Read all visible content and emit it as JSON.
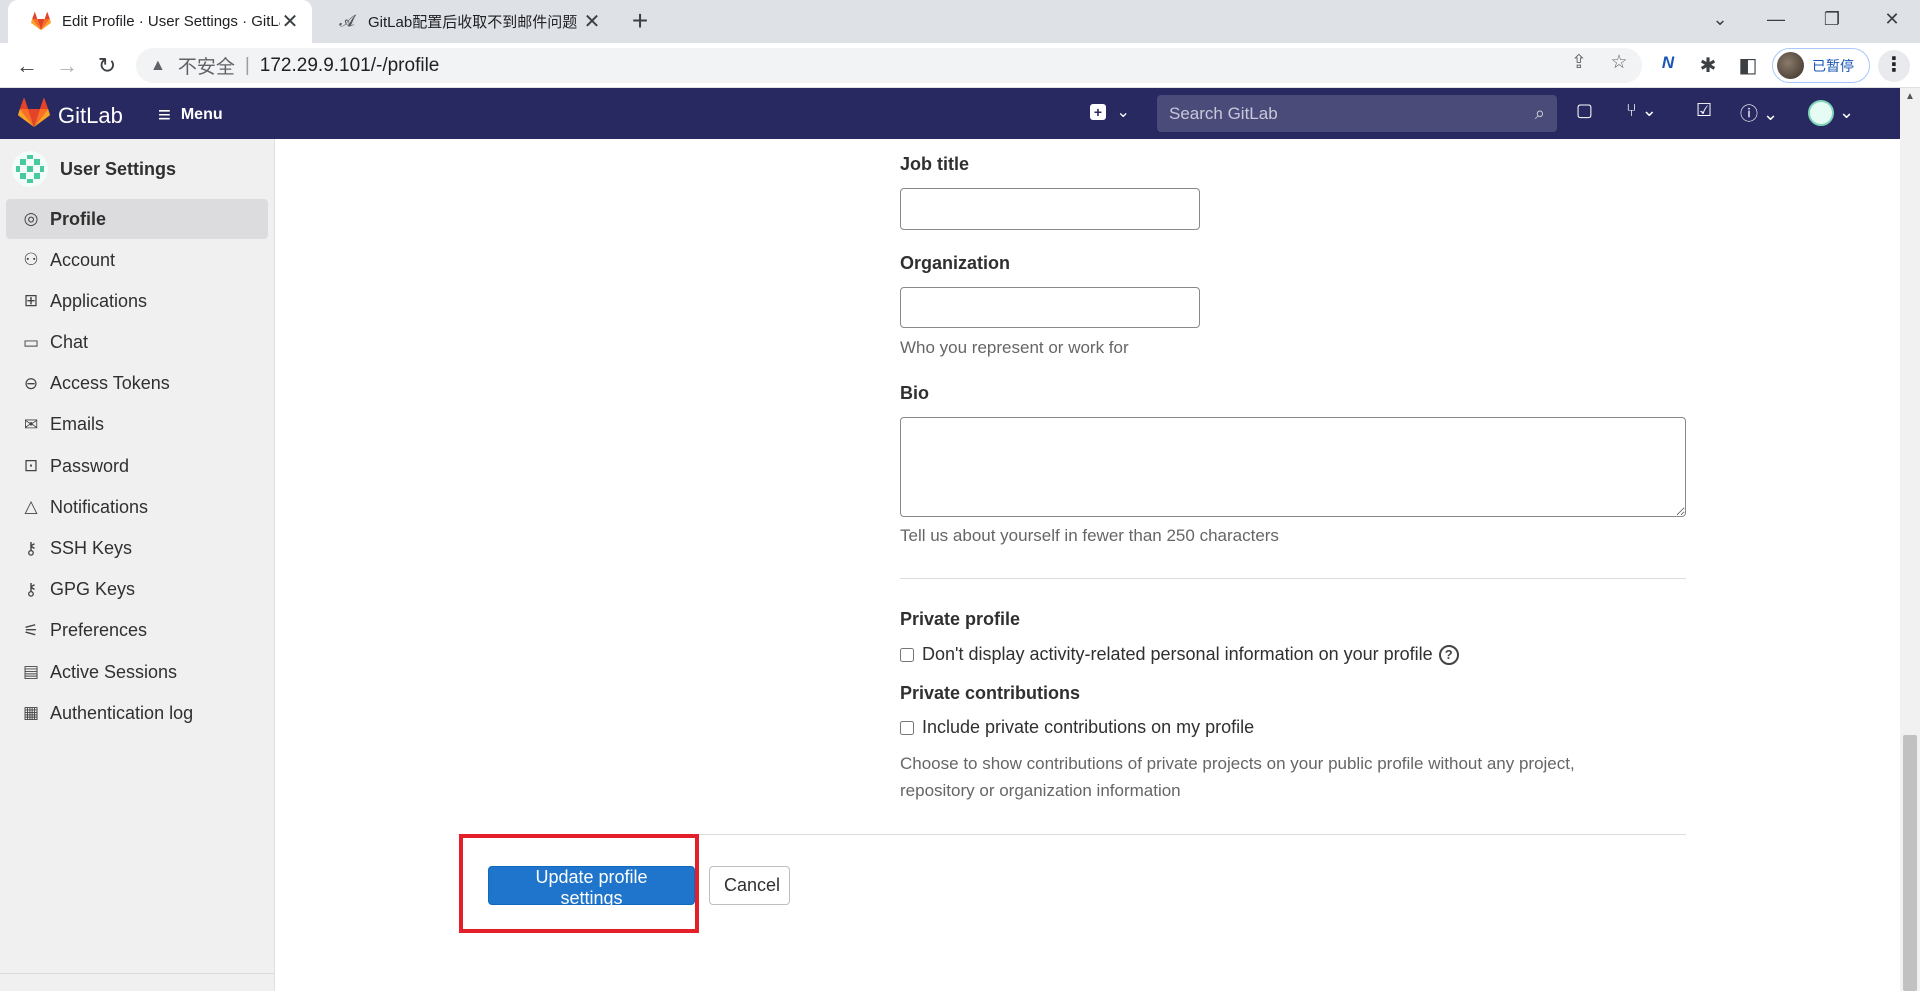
{
  "browser": {
    "tabs": [
      {
        "title": "Edit Profile · User Settings · GitLab",
        "active": true,
        "favicon": "gitlab-fox-icon"
      },
      {
        "title": "GitLab配置后收取不到邮件问题",
        "active": false,
        "favicon": "site-icon"
      }
    ],
    "address": {
      "security_label": "不安全",
      "url": "172.29.9.101/-/profile"
    },
    "profile_chip_label": "已暂停",
    "colors": {
      "tabstrip": "#dee1e6",
      "chip_text": "#1a56b5"
    }
  },
  "gitlab_header": {
    "brand": "GitLab",
    "menu_label": "Menu",
    "search_placeholder": "Search GitLab",
    "colors": {
      "background": "#292961"
    }
  },
  "sidebar": {
    "title": "User Settings",
    "items": [
      {
        "label": "Profile",
        "icon": "profile-icon",
        "active": true
      },
      {
        "label": "Account",
        "icon": "account-icon",
        "active": false
      },
      {
        "label": "Applications",
        "icon": "applications-icon",
        "active": false
      },
      {
        "label": "Chat",
        "icon": "chat-icon",
        "active": false
      },
      {
        "label": "Access Tokens",
        "icon": "token-icon",
        "active": false
      },
      {
        "label": "Emails",
        "icon": "mail-icon",
        "active": false
      },
      {
        "label": "Password",
        "icon": "lock-icon",
        "active": false
      },
      {
        "label": "Notifications",
        "icon": "bell-icon",
        "active": false
      },
      {
        "label": "SSH Keys",
        "icon": "key-icon",
        "active": false
      },
      {
        "label": "GPG Keys",
        "icon": "key-icon",
        "active": false
      },
      {
        "label": "Preferences",
        "icon": "preferences-icon",
        "active": false
      },
      {
        "label": "Active Sessions",
        "icon": "monitor-icon",
        "active": false
      },
      {
        "label": "Authentication log",
        "icon": "log-icon",
        "active": false
      }
    ]
  },
  "form": {
    "job_title": {
      "label": "Job title",
      "value": ""
    },
    "organization": {
      "label": "Organization",
      "value": "",
      "help": "Who you represent or work for"
    },
    "bio": {
      "label": "Bio",
      "value": "",
      "help": "Tell us about yourself in fewer than 250 characters"
    },
    "private_profile": {
      "heading": "Private profile",
      "checkbox_label": "Don't display activity-related personal information on your profile",
      "checked": false
    },
    "private_contributions": {
      "heading": "Private contributions",
      "checkbox_label": "Include private contributions on my profile",
      "checked": false,
      "help_line1": "Choose to show contributions of private projects on your public profile without any project,",
      "help_line2": "repository or organization information"
    },
    "submit_label": "Update profile settings",
    "cancel_label": "Cancel",
    "colors": {
      "primary_button": "#1f75cb",
      "highlight": "#e3202a"
    }
  }
}
